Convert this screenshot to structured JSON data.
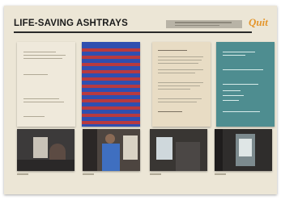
{
  "header": {
    "title": "LIFE-SAVING ASHTRAYS",
    "logo": "Quit"
  },
  "panels": [
    {
      "name": "document-panel",
      "color": "#efe9db"
    },
    {
      "name": "striped-panel",
      "colors": [
        "#2f4fb0",
        "#b83a3f"
      ]
    },
    {
      "name": "aged-document-panel",
      "color": "#e8dcc4"
    },
    {
      "name": "teal-panel",
      "color": "#4e8d90"
    }
  ],
  "photos": [
    {
      "name": "photo-ashtray-wall"
    },
    {
      "name": "photo-man-smoking"
    },
    {
      "name": "photo-ashtray-closeup"
    },
    {
      "name": "photo-ashtray-door"
    }
  ],
  "colors": {
    "board": "#ece6d6",
    "logo": "#e4952a"
  }
}
